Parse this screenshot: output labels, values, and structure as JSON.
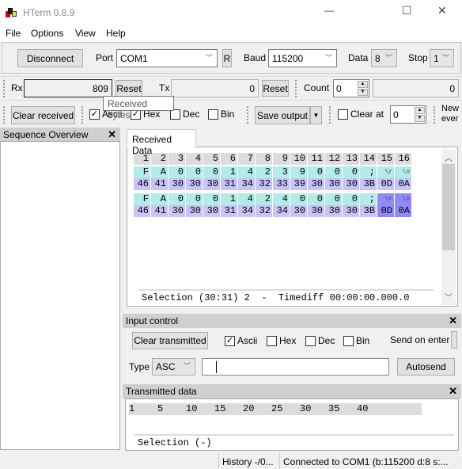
{
  "window": {
    "title": "HTerm 0.8.9",
    "minimize": "—",
    "maximize": "☐",
    "close": "✕"
  },
  "menu": [
    "File",
    "Options",
    "View",
    "Help"
  ],
  "connection": {
    "disconnect": "Disconnect",
    "port_label": "Port",
    "port": "COM1",
    "r_button": "R",
    "baud_label": "Baud",
    "baud": "115200",
    "data_label": "Data",
    "data": "8",
    "stop_label": "Stop",
    "stop": "1"
  },
  "counters": {
    "rx_label": "Rx",
    "rx": "809",
    "reset": "Reset",
    "tx_label": "Tx",
    "tx": "0",
    "count_label": "Count",
    "count": "0",
    "count_display": "0"
  },
  "tooltip": "Received bytes",
  "received_options": {
    "clear_received": "Clear received",
    "ascii": "Ascii",
    "ascii_checked": true,
    "hex": "Hex",
    "hex_checked": true,
    "dec": "Dec",
    "dec_checked": false,
    "bin": "Bin",
    "bin_checked": false,
    "save_output": "Save output",
    "clear_at": "Clear at",
    "clear_at_checked": false,
    "clear_at_value": "0",
    "new_every": "New ever"
  },
  "sequence_overview": {
    "title": "Sequence Overview",
    "close": "✕"
  },
  "received": {
    "tab": "Received Data",
    "columns": [
      "1",
      "2",
      "3",
      "4",
      "5",
      "6",
      "7",
      "8",
      "9",
      "10",
      "11",
      "12",
      "13",
      "14",
      "15",
      "16"
    ],
    "rows": [
      {
        "ascii": [
          "F",
          "A",
          "0",
          "0",
          "0",
          "1",
          "4",
          "2",
          "3",
          "9",
          "0",
          "0",
          "0",
          ";",
          "\\r",
          "\\n"
        ],
        "hex": [
          "46",
          "41",
          "30",
          "30",
          "30",
          "31",
          "34",
          "32",
          "33",
          "39",
          "30",
          "30",
          "30",
          "3B",
          "0D",
          "0A"
        ]
      },
      {
        "ascii": [
          "F",
          "A",
          "0",
          "0",
          "0",
          "1",
          "4",
          "2",
          "4",
          "0",
          "0",
          "0",
          "0",
          ";",
          "\\r",
          "\\n"
        ],
        "hex": [
          "46",
          "41",
          "30",
          "30",
          "30",
          "31",
          "34",
          "32",
          "34",
          "30",
          "30",
          "30",
          "30",
          "3B",
          "0D",
          "0A"
        ]
      }
    ],
    "status": "Selection (30:31) 2  -  Timediff 00:00:00.000.0",
    "colors": {
      "ascii": "#b2ebe8",
      "hex": "#c8c4f8",
      "selected": "#8f8af5",
      "header": "#dcdcdc"
    }
  },
  "input_control": {
    "title": "Input control",
    "close": "✕",
    "clear_transmitted": "Clear transmitted",
    "ascii": "Ascii",
    "hex": "Hex",
    "dec": "Dec",
    "bin": "Bin",
    "send_on_enter": "Send on enter",
    "type_label": "Type",
    "type": "ASC",
    "input_value": "",
    "autosend": "Autosend"
  },
  "transmitted": {
    "title": "Transmitted data",
    "close": "✕",
    "ruler": "1    5    10   15   20   25   30   35   40",
    "status": "Selection (-)"
  },
  "statusbar": {
    "history": "History -/0...",
    "connection": "Connected to COM1 (b:115200 d:8 s:..."
  }
}
